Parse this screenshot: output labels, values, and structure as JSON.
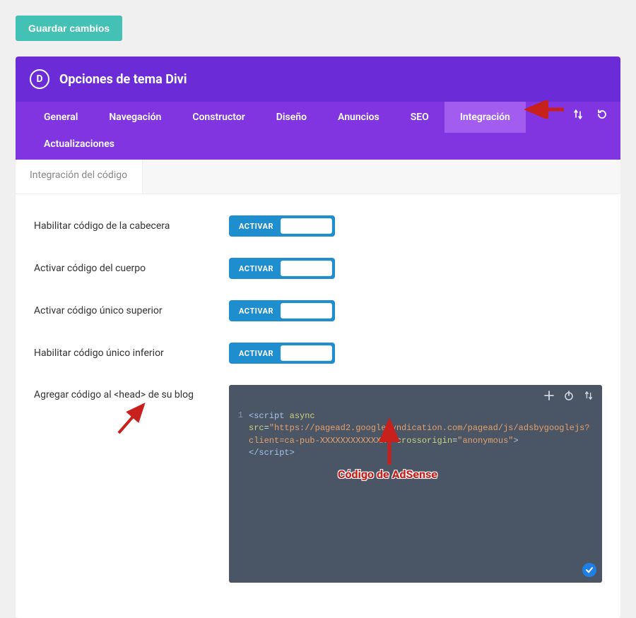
{
  "buttons": {
    "save": "Guardar cambios"
  },
  "header": {
    "title": "Opciones de tema Divi",
    "logo_letter": "D"
  },
  "tabs": [
    {
      "label": "General"
    },
    {
      "label": "Navegación"
    },
    {
      "label": "Constructor"
    },
    {
      "label": "Diseño"
    },
    {
      "label": "Anuncios"
    },
    {
      "label": "SEO"
    },
    {
      "label": "Integración",
      "active": true
    },
    {
      "label": "Actualizaciones"
    }
  ],
  "subtab": {
    "label": "Integración del código"
  },
  "toggles": [
    {
      "label": "Habilitar código de la cabecera",
      "state": "ACTIVAR"
    },
    {
      "label": "Activar código del cuerpo",
      "state": "ACTIVAR"
    },
    {
      "label": "Activar código único superior",
      "state": "ACTIVAR"
    },
    {
      "label": "Habilitar código único inferior",
      "state": "ACTIVAR"
    }
  ],
  "head_code": {
    "label": "Agregar código al <head> de su blog",
    "line_number": "1",
    "tokens": {
      "open1": "<script",
      "async": " async",
      "src_attr": "src",
      "eq": "=",
      "src_val": "\"https://pagead2.googlesyndication.com/pagead/js/adsbygooglejs?client=ca-pub-XXXXXXXXXXXXX\"",
      "cross_attr": "crossorigin",
      "cross_val": "\"anonymous\"",
      "close1": ">",
      "close2": "</script>"
    }
  },
  "annotations": {
    "adsense_label": "Código de AdSense"
  }
}
